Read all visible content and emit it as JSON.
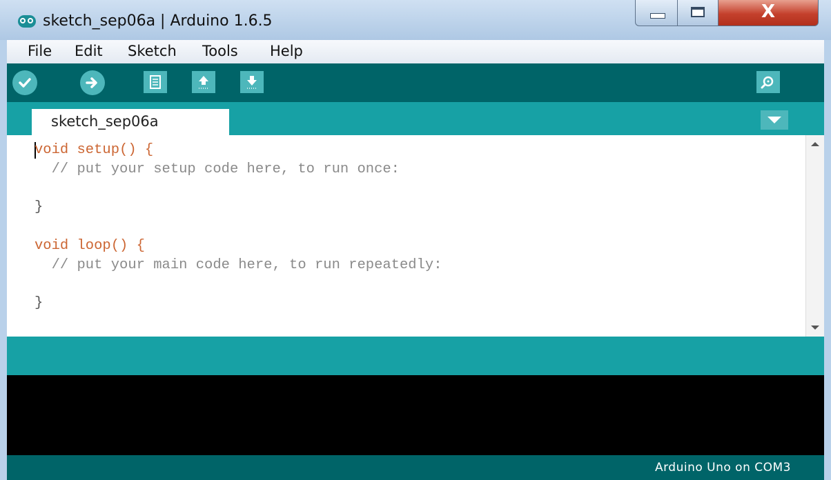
{
  "window": {
    "title": "sketch_sep06a | Arduino 1.6.5",
    "close_glyph": "X"
  },
  "menu": [
    "File",
    "Edit",
    "Sketch",
    "Tools",
    "Help"
  ],
  "toolbar": {
    "buttons": [
      "verify-icon",
      "upload-icon",
      "new-icon",
      "open-icon",
      "save-icon"
    ],
    "right_button": "serial-monitor-icon"
  },
  "tabs": {
    "active": "sketch_sep06a",
    "menu_icon": "chevron-down-icon"
  },
  "editor": {
    "lines": [
      "void setup() {",
      "  // put your setup code here, to run once:",
      "",
      "}",
      "",
      "void loop() {",
      "  // put your main code here, to run repeatedly:",
      "",
      "}"
    ]
  },
  "status": {
    "board": "Arduino Uno on COM3"
  },
  "colors": {
    "toolbar": "#006468",
    "accent": "#17a1a5",
    "button": "#4db7bb",
    "keyword": "#cc6633"
  }
}
